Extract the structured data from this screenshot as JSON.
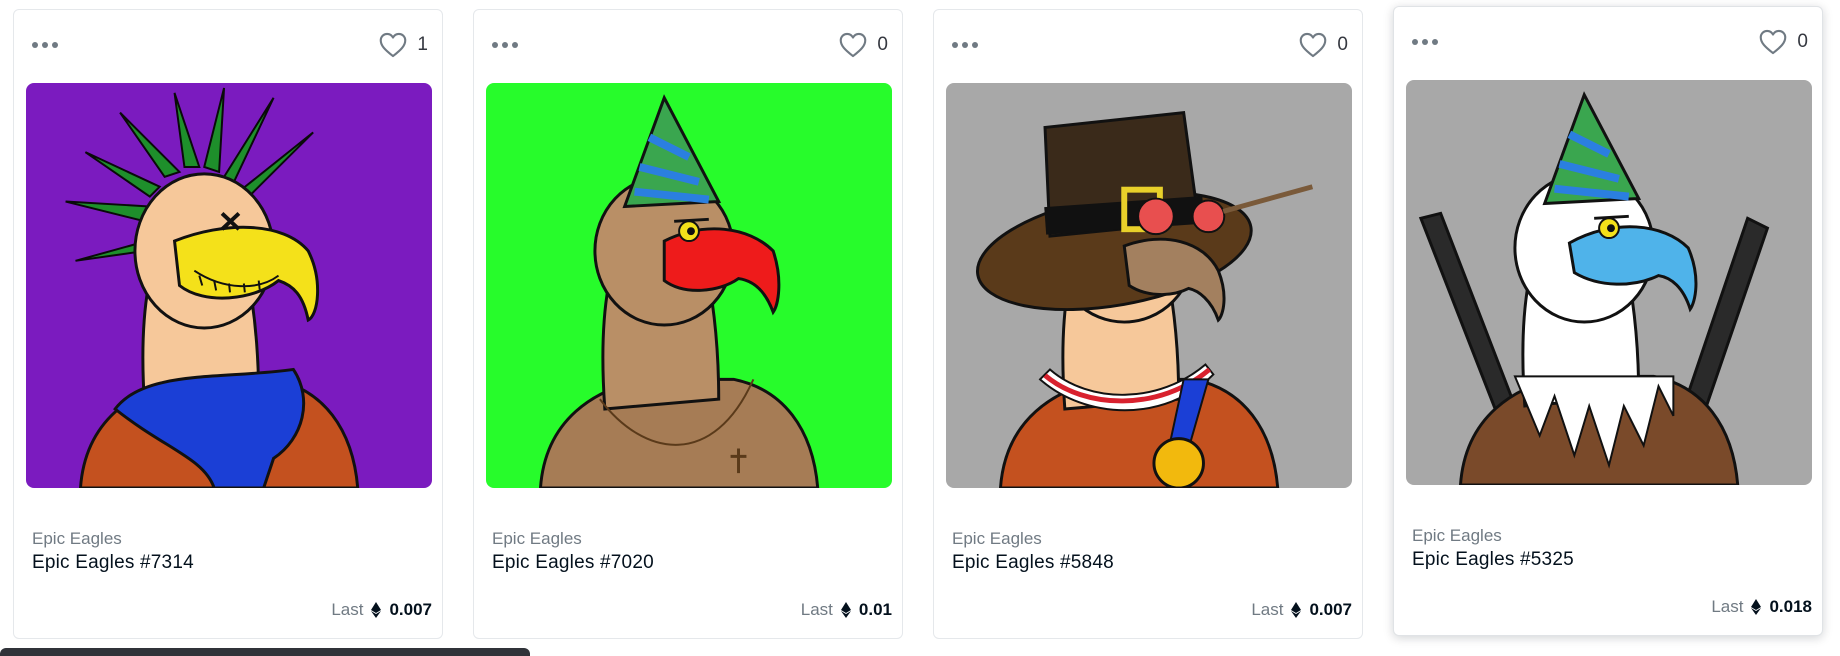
{
  "cards": [
    {
      "favorites": "1",
      "collection": "Epic Eagles",
      "name": "Epic Eagles #7314",
      "last_label": "Last",
      "price": "0.007",
      "background": "#7b1bbf",
      "beak": "#f4e11a",
      "head": "#f6c89a",
      "accent": "#1b3fd6",
      "body": "#c4511f"
    },
    {
      "favorites": "0",
      "collection": "Epic Eagles",
      "name": "Epic Eagles #7020",
      "last_label": "Last",
      "price": "0.01",
      "background": "#27fc2b",
      "beak": "#ee1b1b",
      "head": "#b98f66",
      "accent": "#3aa64f",
      "body": "#a67c55"
    },
    {
      "favorites": "0",
      "collection": "Epic Eagles",
      "name": "Epic Eagles #5848",
      "last_label": "Last",
      "price": "0.007",
      "background": "#a8a8a8",
      "beak": "#a3805f",
      "head": "#f6c89a",
      "accent": "#3a2a1a",
      "body": "#c4511f"
    },
    {
      "favorites": "0",
      "collection": "Epic Eagles",
      "name": "Epic Eagles #5325",
      "last_label": "Last",
      "price": "0.018",
      "background": "#a8a8a8",
      "beak": "#4fb3ea",
      "head": "#ffffff",
      "accent": "#3aa64f",
      "body": "#7a4a2a"
    }
  ]
}
